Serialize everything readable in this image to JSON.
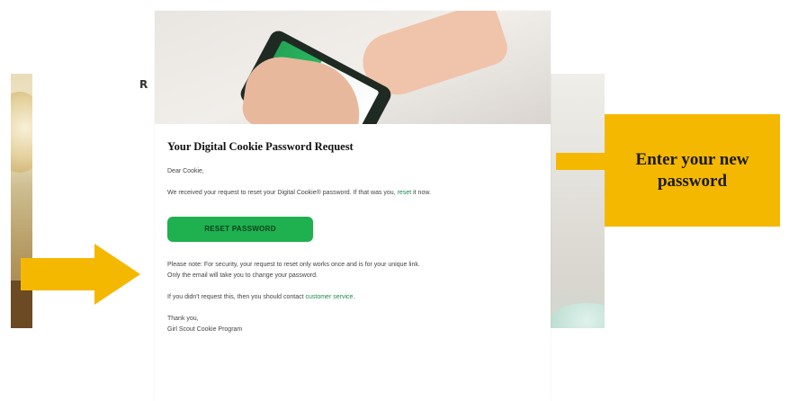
{
  "email": {
    "title": "Your Digital Cookie Password Request",
    "greeting": "Dear Cookie,",
    "intro": "We received your request to reset your Digital Cookie® password. If that was you, ",
    "intro_link": "reset",
    "intro_end": " it now.",
    "button_label": "RESET PASSWORD",
    "note_line1": "Please note: For security, your request to reset only works once and is for your unique link.",
    "note_line2": "Only the email will take you to change your password.",
    "help_text": "If you didn't request this, then you should contact ",
    "help_link": "customer service",
    "help_end": ".",
    "sign_off": "Thank you,",
    "signature": "Girl Scout Cookie Program"
  },
  "callout": {
    "text": "Enter your new password"
  },
  "colors": {
    "callout": "#f5b800",
    "button": "#1fb04f",
    "link": "#1a8a4a"
  }
}
